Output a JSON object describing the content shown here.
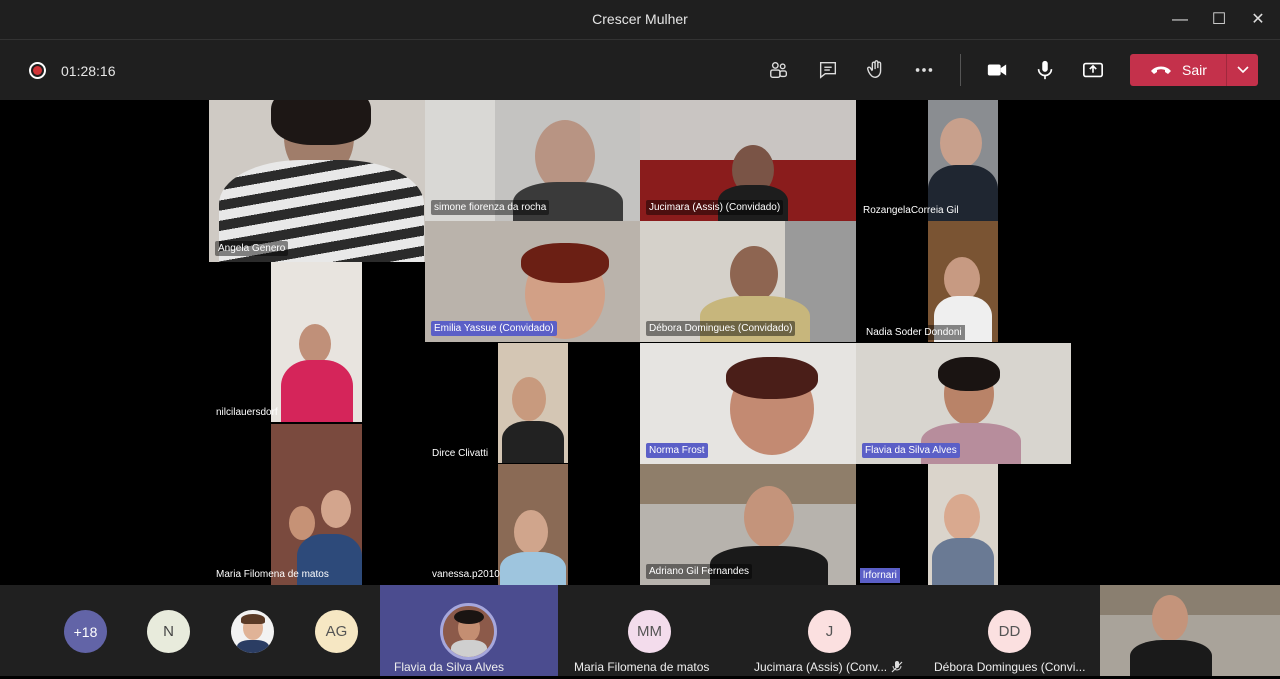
{
  "window": {
    "title": "Crescer Mulher"
  },
  "toolbar": {
    "timer": "01:28:16",
    "leave_label": "Sair"
  },
  "tiles": [
    {
      "name": "Angela Genero"
    },
    {
      "name": "simone fiorenza da rocha"
    },
    {
      "name": "Jucimara (Assis) (Convidado)"
    },
    {
      "name": "RozangelaCorreia Gil"
    },
    {
      "name": "Emilia Yassue (Convidado)"
    },
    {
      "name": "Débora Domingues (Convidado)"
    },
    {
      "name": "Nadia Soder Dondoni"
    },
    {
      "name": "nilcilauersdorf"
    },
    {
      "name": "Dirce Clivatti"
    },
    {
      "name": "Norma Frost"
    },
    {
      "name": "Flavia da Silva Alves"
    },
    {
      "name": "Maria Filomena de matos"
    },
    {
      "name": "vanessa.p2010"
    },
    {
      "name": "Adriano Gil Fernandes"
    },
    {
      "name": "lrfornari"
    }
  ],
  "tray": {
    "overflow": "+18",
    "avatars": [
      {
        "initials": "N"
      },
      {
        "initials": "AG"
      },
      {
        "initials": "MM",
        "name": "Maria Filomena de matos"
      },
      {
        "initials": "J",
        "name": "Jucimara (Assis) (Conv..."
      },
      {
        "initials": "DD",
        "name": "Débora Domingues (Convi..."
      }
    ],
    "featured_name": "Flavia da Silva Alves"
  },
  "colors": {
    "leave": "#c4314b",
    "highlight": "#5b5fc7",
    "record": "#d13438"
  }
}
